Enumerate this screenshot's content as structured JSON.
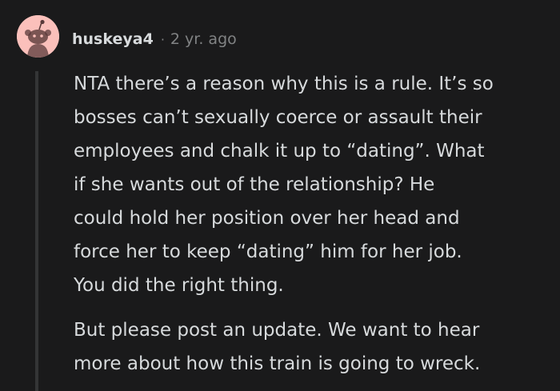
{
  "comment": {
    "author": "huskeya4",
    "separator": "·",
    "timestamp": "2 yr. ago",
    "avatar_icon": "snoo-avatar-icon",
    "colors": {
      "background": "#1a1a1b",
      "text": "#d7dadc",
      "meta": "#818384",
      "thread_line": "#343536",
      "avatar_bg": "#fbc0bb"
    },
    "paragraphs": [
      "NTA there’s a reason why this is a rule. It’s so\nbosses can’t sexually coerce or assault their\nemployees and chalk it up to “dating”. What\nif she wants out of the relationship? He\ncould hold her position over her head and\nforce her to keep “dating” him for her job.\nYou did the right thing.",
      "But please post an update. We want to hear\nmore about how this train is going to wreck."
    ]
  }
}
